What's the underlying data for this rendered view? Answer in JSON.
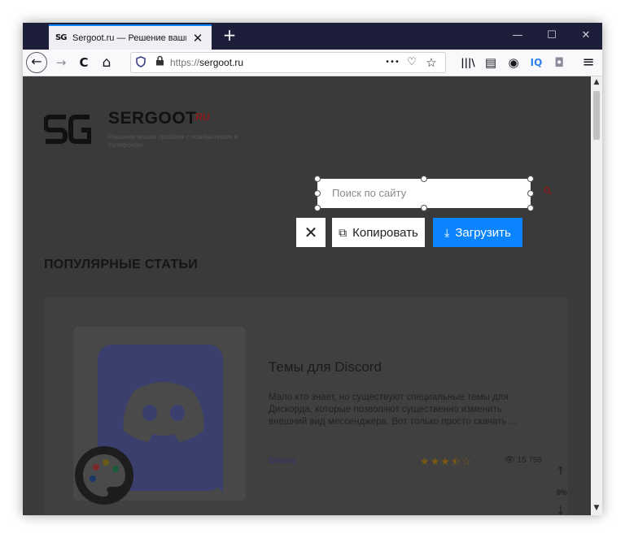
{
  "browser": {
    "tab": {
      "favicon_text": "SG",
      "title": "Sergoot.ru — Решение ваших",
      "close": "✕"
    },
    "new_tab": "+",
    "window_controls": {
      "minimize": "—",
      "maximize": "☐",
      "close": "✕"
    },
    "nav": {
      "back": "←",
      "forward": "→",
      "reload": "C",
      "home": "⌂",
      "url_protocol": "https://",
      "url_host": "sergoot.ru",
      "more": "•••",
      "pocket": "♡",
      "bookmark": "☆",
      "library": "|||\\",
      "sidebar": "▤",
      "account": "◉",
      "iq": "IQ",
      "extension": "◘",
      "menu": "≡"
    },
    "scroll": {
      "up": "▲",
      "down": "▼"
    }
  },
  "page": {
    "site_name": "SERGOOT",
    "site_tld": ".RU",
    "tagline": "Решение ваших проблем с компьютером и телефоном",
    "search": {
      "placeholder": "Поиск по сайту"
    },
    "section_title": "ПОПУЛЯРНЫЕ СТАТЬИ",
    "article": {
      "title": "Темы для Discord",
      "description": "Мало кто знает, но существуют специальные темы для Дискорда, которые позволяют существенно изменить внешний вид мессенджера. Вот только просто скачать ...",
      "tag": "Discord",
      "rating_stars": "★★★⯪☆",
      "rating": 3.5,
      "views": "👁 15 756"
    },
    "floating_nav": {
      "up": "↑",
      "percent": "0%",
      "down": "↓"
    }
  },
  "screenshot_toolbar": {
    "close": "✕",
    "copy_icon": "⧉",
    "copy_label": "Копировать",
    "upload_icon": "⤓",
    "upload_label": "Загрузить"
  },
  "colors": {
    "tab_strip": "#1d1e3a",
    "accent": "#0a84ff",
    "page_dim": "#3a3a3a"
  }
}
